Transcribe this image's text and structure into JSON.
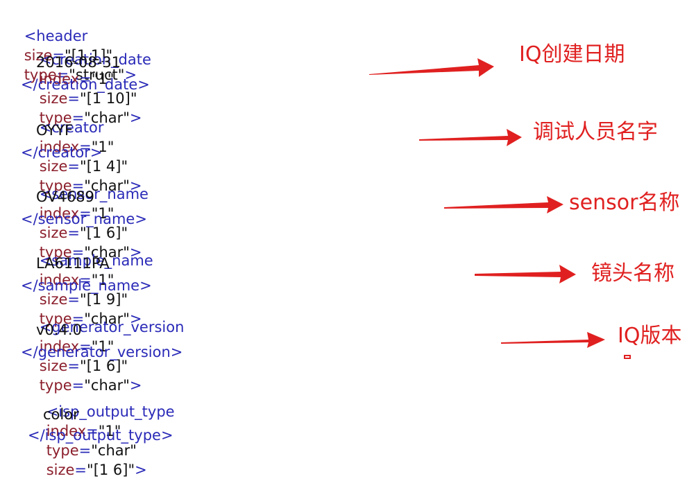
{
  "xml": {
    "header_open": {
      "tag": "<header",
      "attrs": [
        {
          "name": "size",
          "value": "\"[1 1]\""
        },
        {
          "name": "type",
          "value": "\"struct\""
        }
      ],
      "close": ">"
    },
    "elements": [
      {
        "name": "creation_date",
        "open_tag": "<creation_date",
        "attrs": [
          {
            "name": "index",
            "value": "\"1\""
          },
          {
            "name": "size",
            "value": "\"[1 10]\""
          },
          {
            "name": "type",
            "value": "\"char\""
          }
        ],
        "content": "2016-08-31",
        "close_tag": "</creation_date>"
      },
      {
        "name": "creator",
        "open_tag": "<creator",
        "attrs": [
          {
            "name": "index",
            "value": "\"1\""
          },
          {
            "name": "size",
            "value": "\"[1 4]\""
          },
          {
            "name": "type",
            "value": "\"char\""
          }
        ],
        "content": "OYYF",
        "close_tag": "</creator>"
      },
      {
        "name": "sensor_name",
        "open_tag": "<sensor_name",
        "attrs": [
          {
            "name": "index",
            "value": "\"1\""
          },
          {
            "name": "size",
            "value": "\"[1 6]\""
          },
          {
            "name": "type",
            "value": "\"char\""
          }
        ],
        "content": "OV4689",
        "close_tag": "</sensor_name>"
      },
      {
        "name": "sample_name",
        "open_tag": "<sample_name",
        "attrs": [
          {
            "name": "index",
            "value": "\"1\""
          },
          {
            "name": "size",
            "value": "\"[1 9]\""
          },
          {
            "name": "type",
            "value": "\"char\""
          }
        ],
        "content": "LA6111PA",
        "close_tag": "</sample_name>"
      },
      {
        "name": "generator_version",
        "open_tag": "<generator_version",
        "attrs": [
          {
            "name": "index",
            "value": "\"1\""
          },
          {
            "name": "size",
            "value": "\"[1 6]\""
          },
          {
            "name": "type",
            "value": "\"char\""
          }
        ],
        "content": "v0.4.0",
        "close_tag": "</generator_version>"
      },
      {
        "name": "isp_output_type",
        "open_tag": "<isp_output_type",
        "attrs": [
          {
            "name": "index",
            "value": "\"1\""
          },
          {
            "name": "type",
            "value": "\"char\""
          },
          {
            "name": "size",
            "value": "\"[1 6]\""
          }
        ],
        "content": "color",
        "close_tag": "</isp_output_type>"
      }
    ]
  },
  "annotations": [
    {
      "label": "IQ创建日期"
    },
    {
      "label": "调试人员名字"
    },
    {
      "label": "sensor名称"
    },
    {
      "label": "镜头名称"
    },
    {
      "label": "IQ版本"
    }
  ],
  "colors": {
    "tag": "#2a2ab8",
    "attr": "#8b1f2c",
    "text": "#111111",
    "annotation": "#e02020"
  }
}
